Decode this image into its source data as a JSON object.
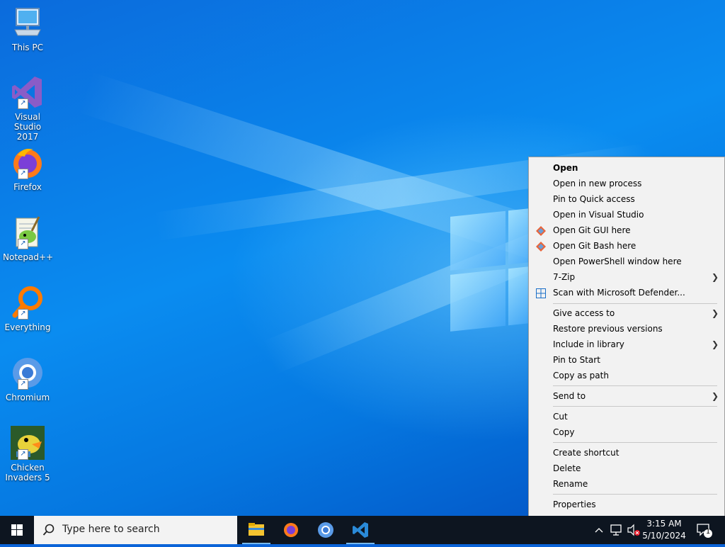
{
  "desktop_icons": [
    {
      "label_1": "This PC",
      "label_2": ""
    },
    {
      "label_1": "Visual Studio",
      "label_2": "2017"
    },
    {
      "label_1": "Firefox",
      "label_2": ""
    },
    {
      "label_1": "Notepad++",
      "label_2": ""
    },
    {
      "label_1": "Everything",
      "label_2": ""
    },
    {
      "label_1": "Chromium",
      "label_2": ""
    },
    {
      "label_1": "Chicken",
      "label_2": "Invaders 5"
    }
  ],
  "context_menu": {
    "open": "Open",
    "open_new_process": "Open in new process",
    "pin_quick_access": "Pin to Quick access",
    "open_visual_studio": "Open in Visual Studio",
    "open_git_gui": "Open Git GUI here",
    "open_git_bash": "Open Git Bash here",
    "open_powershell": "Open PowerShell window here",
    "seven_zip": "7-Zip",
    "scan_defender": "Scan with Microsoft Defender...",
    "give_access": "Give access to",
    "restore_versions": "Restore previous versions",
    "include_library": "Include in library",
    "pin_start": "Pin to Start",
    "copy_as_path": "Copy as path",
    "send_to": "Send to",
    "cut": "Cut",
    "copy": "Copy",
    "create_shortcut": "Create shortcut",
    "delete": "Delete",
    "rename": "Rename",
    "properties": "Properties"
  },
  "taskbar": {
    "search_placeholder": "Type here to search",
    "time": "3:15 AM",
    "date": "5/10/2024",
    "notification_count": "1",
    "apps": [
      "file-explorer-icon",
      "firefox-icon",
      "chromium-icon",
      "vscode-icon"
    ]
  },
  "colors": {
    "menu_bg": "#f2f2f2",
    "taskbar_bg": "#0d1520",
    "desktop_blue": "#0a63d8"
  }
}
